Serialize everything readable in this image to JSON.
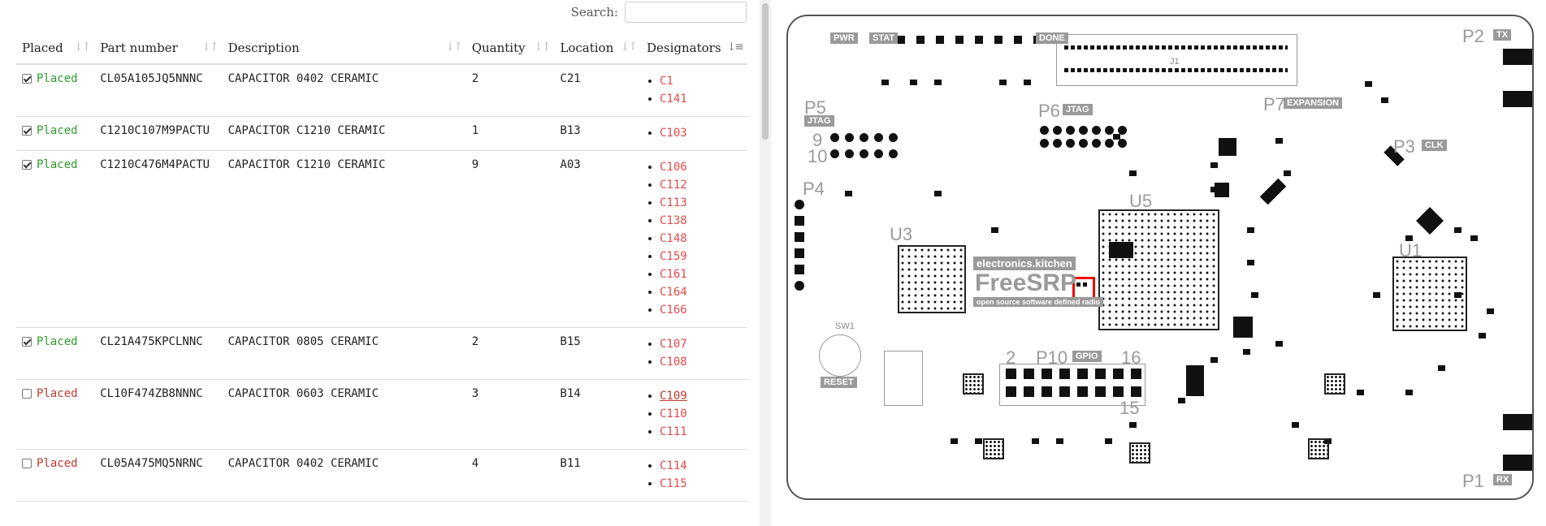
{
  "search": {
    "label": "Search:",
    "value": ""
  },
  "columns": {
    "placed": "Placed",
    "part": "Part number",
    "desc": "Description",
    "qty": "Quantity",
    "loc": "Location",
    "des": "Designators"
  },
  "rows": [
    {
      "checked": true,
      "placed": "Placed",
      "part": "CL05A105JQ5NNNC",
      "desc": "CAPACITOR 0402 CERAMIC",
      "qty": "2",
      "loc": "C21",
      "designators": [
        "C1",
        "C141"
      ]
    },
    {
      "checked": true,
      "placed": "Placed",
      "part": "C1210C107M9PACTU",
      "desc": "CAPACITOR C1210 CERAMIC",
      "qty": "1",
      "loc": "B13",
      "designators": [
        "C103"
      ]
    },
    {
      "checked": true,
      "placed": "Placed",
      "part": "C1210C476M4PACTU",
      "desc": "CAPACITOR C1210 CERAMIC",
      "qty": "9",
      "loc": "A03",
      "designators": [
        "C106",
        "C112",
        "C113",
        "C138",
        "C148",
        "C159",
        "C161",
        "C164",
        "C166"
      ]
    },
    {
      "checked": true,
      "placed": "Placed",
      "part": "CL21A475KPCLNNC",
      "desc": "CAPACITOR 0805 CERAMIC",
      "qty": "2",
      "loc": "B15",
      "designators": [
        "C107",
        "C108"
      ]
    },
    {
      "checked": false,
      "placed": "Placed",
      "part": "CL10F474ZB8NNNC",
      "desc": "CAPACITOR 0603 CERAMIC",
      "qty": "3",
      "loc": "B14",
      "designators": [
        "C109",
        "C110",
        "C111"
      ]
    },
    {
      "checked": false,
      "placed": "Placed",
      "part": "CL05A475MQ5NRNC",
      "desc": "CAPACITOR 0402 CERAMIC",
      "qty": "4",
      "loc": "B11",
      "designators": [
        "C114",
        "C115"
      ]
    }
  ],
  "board": {
    "brand": "electronics.kitchen",
    "name": "FreeSRP",
    "tagline": "open source software defined radio",
    "labels": {
      "p1": "P1",
      "rx": "RX",
      "p2": "P2",
      "tx": "TX",
      "p3": "P3",
      "clk": "CLK",
      "p4": "P4",
      "p5": "P5",
      "p6": "P6",
      "p7": "P7",
      "expansion": "EXPANSION",
      "jtag": "JTAG",
      "p10": "P10",
      "gpio": "GPIO",
      "pwr": "PWR",
      "stat": "STAT",
      "done": "DONE",
      "u1": "U1",
      "u3": "U3",
      "u5": "U5",
      "reset": "RESET",
      "sw1": "SW1",
      "j1": "J1",
      "n2": "2",
      "n16": "16",
      "n9": "9",
      "n10": "10",
      "n15": "15"
    },
    "highlight_color": "#ee0000"
  }
}
